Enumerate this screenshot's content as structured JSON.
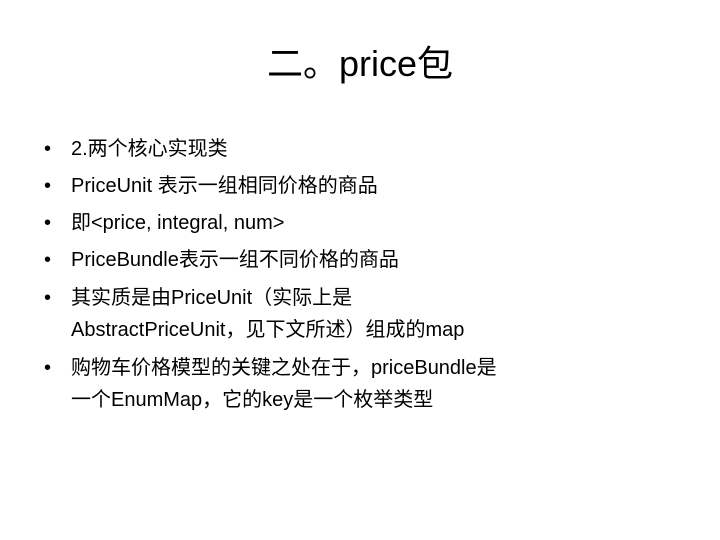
{
  "slide": {
    "title": "二。price包",
    "bullet_symbol": "•",
    "bullets": [
      {
        "lines": [
          "2.两个核心实现类"
        ]
      },
      {
        "lines": [
          "PriceUnit 表示一组相同价格的商品"
        ]
      },
      {
        "lines": [
          "即<price, integral, num>"
        ]
      },
      {
        "lines": [
          "PriceBundle表示一组不同价格的商品"
        ]
      },
      {
        "lines": [
          "其实质是由PriceUnit（实际上是",
          "AbstractPriceUnit，见下文所述）组成的map"
        ]
      },
      {
        "lines": [
          "购物车价格模型的关键之处在于，priceBundle是",
          "一个EnumMap，它的key是一个枚举类型"
        ]
      }
    ]
  }
}
